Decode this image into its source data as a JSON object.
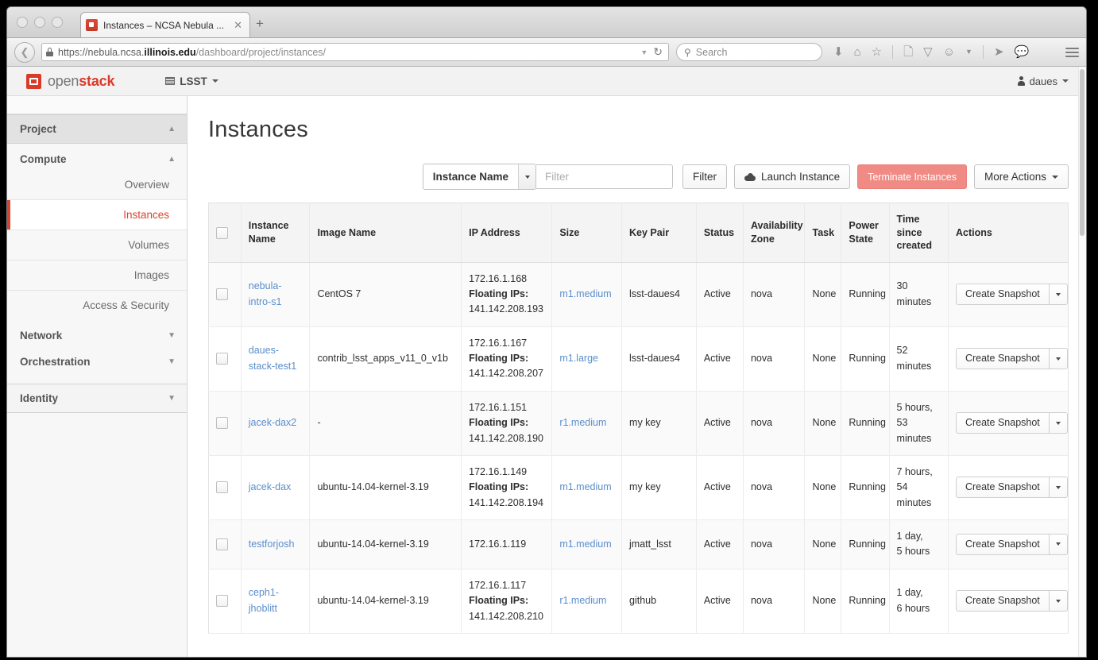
{
  "browser": {
    "tab": {
      "title": "Instances – NCSA Nebula ...",
      "favicon": "openstack-favicon",
      "close": "✕"
    },
    "new_tab": "+",
    "url_prefix": "https://nebula.ncsa.",
    "url_domain": "illinois.edu",
    "url_path": "/dashboard/project/instances/",
    "search_placeholder": "Search",
    "toolbar_icons": [
      "download-icon",
      "home-icon",
      "star-icon",
      "reading-list-icon",
      "pocket-icon",
      "persona-icon",
      "caret-icon",
      "send-icon",
      "chat-icon"
    ]
  },
  "topbar": {
    "brand_open": "open",
    "brand_stack": "stack",
    "project": "LSST",
    "user": "daues"
  },
  "sidebar": {
    "project_label": "Project",
    "compute_label": "Compute",
    "compute_links": [
      "Overview",
      "Instances",
      "Volumes",
      "Images",
      "Access & Security"
    ],
    "active_link": "Instances",
    "network_label": "Network",
    "orchestration_label": "Orchestration",
    "identity_label": "Identity"
  },
  "main": {
    "title": "Instances",
    "toolbar": {
      "filter_select_value": "Instance Name",
      "filter_placeholder": "Filter",
      "filter_value": "",
      "filter_button": "Filter",
      "launch_button": "Launch Instance",
      "terminate_button": "Terminate Instances",
      "more_button": "More Actions"
    },
    "table": {
      "columns": [
        "Instance Name",
        "Image Name",
        "IP Address",
        "Size",
        "Key Pair",
        "Status",
        "Availability Zone",
        "Task",
        "Power State",
        "Time since created",
        "Actions"
      ],
      "floating_ips_label": "Floating IPs:",
      "action_button": "Create Snapshot",
      "rows": [
        {
          "name": "nebula-intro-s1",
          "image": "CentOS 7",
          "ip": "172.16.1.168",
          "floating_ip": "141.142.208.193",
          "size": "m1.medium",
          "key_pair": "lsst-daues4",
          "status": "Active",
          "zone": "nova",
          "task": "None",
          "power": "Running",
          "time": "30 minutes"
        },
        {
          "name": "daues-stack-test1",
          "image": "contrib_lsst_apps_v11_0_v1b",
          "ip": "172.16.1.167",
          "floating_ip": "141.142.208.207",
          "size": "m1.large",
          "key_pair": "lsst-daues4",
          "status": "Active",
          "zone": "nova",
          "task": "None",
          "power": "Running",
          "time": "52 minutes"
        },
        {
          "name": "jacek-dax2",
          "image": "-",
          "ip": "172.16.1.151",
          "floating_ip": "141.142.208.190",
          "size": "r1.medium",
          "key_pair": "my key",
          "status": "Active",
          "zone": "nova",
          "task": "None",
          "power": "Running",
          "time": "5 hours, 53 minutes"
        },
        {
          "name": "jacek-dax",
          "image": "ubuntu-14.04-kernel-3.19",
          "ip": "172.16.1.149",
          "floating_ip": "141.142.208.194",
          "size": "m1.medium",
          "key_pair": "my key",
          "status": "Active",
          "zone": "nova",
          "task": "None",
          "power": "Running",
          "time": "7 hours, 54 minutes"
        },
        {
          "name": "testforjosh",
          "image": "ubuntu-14.04-kernel-3.19",
          "ip": "172.16.1.119",
          "floating_ip": "",
          "size": "m1.medium",
          "key_pair": "jmatt_lsst",
          "status": "Active",
          "zone": "nova",
          "task": "None",
          "power": "Running",
          "time": "1 day, 5 hours"
        },
        {
          "name": "ceph1-jhoblitt",
          "image": "ubuntu-14.04-kernel-3.19",
          "ip": "172.16.1.117",
          "floating_ip": "141.142.208.210",
          "size": "r1.medium",
          "key_pair": "github",
          "status": "Active",
          "zone": "nova",
          "task": "None",
          "power": "Running",
          "time": "1 day, 6 hours"
        }
      ]
    }
  },
  "colors": {
    "accent": "#d9422e",
    "danger": "#ef8b84",
    "link": "#5b8ecb"
  }
}
